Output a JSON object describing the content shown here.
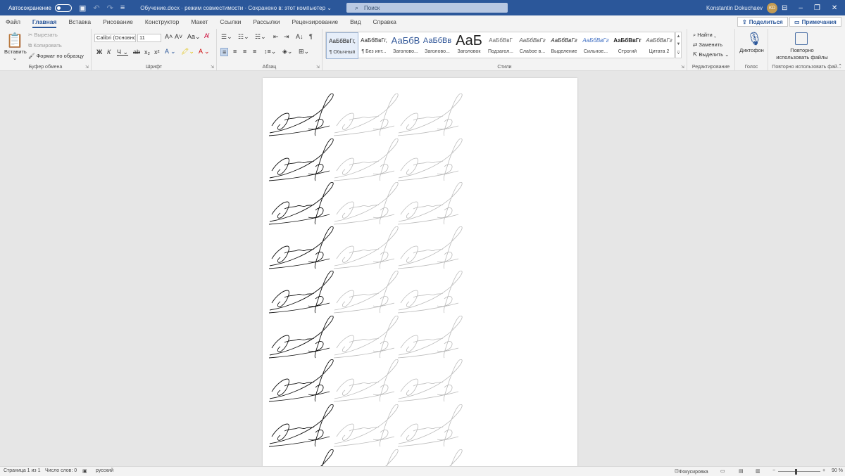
{
  "titlebar": {
    "autosave_label": "Автосохранение",
    "doc_title": "Обучение.docx  ·  режим совместимости  ·  Сохранено в: этот компьютер",
    "search_placeholder": "Поиск",
    "user_name": "Konstantin Dokuchaev",
    "user_initials": "KD",
    "accent_color": "#2b579a"
  },
  "tabs": [
    "Файл",
    "Главная",
    "Вставка",
    "Рисование",
    "Конструктор",
    "Макет",
    "Ссылки",
    "Рассылки",
    "Рецензирование",
    "Вид",
    "Справка"
  ],
  "active_tab": "Главная",
  "share_label": "Поделиться",
  "notes_label": "Примечания",
  "ribbon": {
    "clipboard": {
      "paste_label": "Вставить",
      "cut_label": "Вырезать",
      "copy_label": "Копировать",
      "format_painter_label": "Формат по образцу",
      "group_label": "Буфер обмена"
    },
    "font": {
      "font_name": "Calibri (Основной",
      "font_size": "11",
      "group_label": "Шрифт"
    },
    "paragraph": {
      "group_label": "Абзац"
    },
    "styles": {
      "group_label": "Стили",
      "items": [
        {
          "sample": "АаБбВвГг,",
          "name": "¶ Обычный"
        },
        {
          "sample": "АаБбВвГг,",
          "name": "¶ Без инт..."
        },
        {
          "sample": "АаБбВ",
          "name": "Заголово..."
        },
        {
          "sample": "АаБбВв",
          "name": "Заголово..."
        },
        {
          "sample": "АаБ",
          "name": "Заголовок"
        },
        {
          "sample": "АаБбВвГ",
          "name": "Подзагол..."
        },
        {
          "sample": "АаБбВвГг",
          "name": "Слабое в..."
        },
        {
          "sample": "АаБбВвГг",
          "name": "Выделение"
        },
        {
          "sample": "АаБбВвГг",
          "name": "Сильное..."
        },
        {
          "sample": "АаБбВвГг",
          "name": "Строгий"
        },
        {
          "sample": "АаБбВвГг",
          "name": "Цитата 2"
        }
      ]
    },
    "editing": {
      "find_label": "Найти",
      "replace_label": "Заменить",
      "select_label": "Выделить",
      "group_label": "Редактирование"
    },
    "voice": {
      "dictate_label": "Диктофон",
      "group_label": "Голос"
    },
    "reuse": {
      "button_label_1": "Повторно",
      "button_label_2": "использовать файлы",
      "group_label": "Повторно использовать фай..."
    }
  },
  "statusbar": {
    "page_info": "Страница 1 из 1",
    "word_count": "Число слов: 0",
    "language": "русский",
    "focus_label": "Фокусировка",
    "zoom_out": "−",
    "zoom_in": "+",
    "zoom": "90 %"
  }
}
